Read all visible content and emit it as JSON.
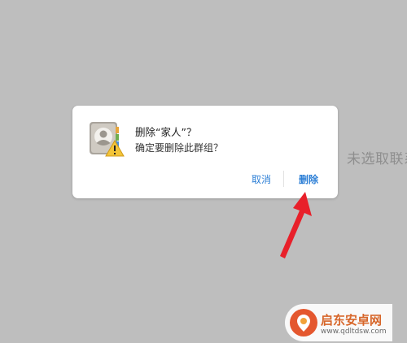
{
  "background": {
    "hint_text": "未选取联系人"
  },
  "dialog": {
    "icon": "contacts-warning-icon",
    "title": "删除“家人”？",
    "message": "确定要删除此群组？",
    "buttons": {
      "cancel_label": "取消",
      "delete_label": "删除"
    }
  },
  "annotation": {
    "icon": "red-arrow-icon",
    "color": "#e8202a"
  },
  "watermark": {
    "name": "启东安卓网",
    "url": "www.qdltdsw.com"
  },
  "colors": {
    "overlay": "#bebebe",
    "dialog_bg": "#ffffff",
    "button_text": "#2d7fd6"
  }
}
